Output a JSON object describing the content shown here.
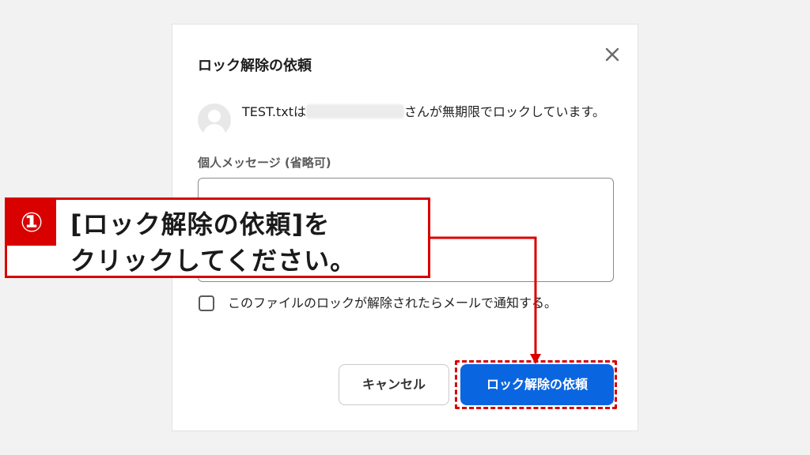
{
  "dialog": {
    "title": "ロック解除の依頼",
    "lock_message_prefix": "TEST.txtは",
    "lock_message_suffix": "さんが無期限でロックしています。",
    "message_label": "個人メッセージ (省略可)",
    "message_value": "",
    "notify_label": "このファイルのロックが解除されたらメールで通知する。",
    "notify_checked": false,
    "cancel_label": "キャンセル",
    "request_label": "ロック解除の依頼"
  },
  "annotation": {
    "step_badge": "①",
    "line1": "[ロック解除の依頼]を",
    "line2": "クリックしてください。"
  },
  "colors": {
    "primary": "#0a66e0",
    "annotation_red": "#d90000"
  }
}
